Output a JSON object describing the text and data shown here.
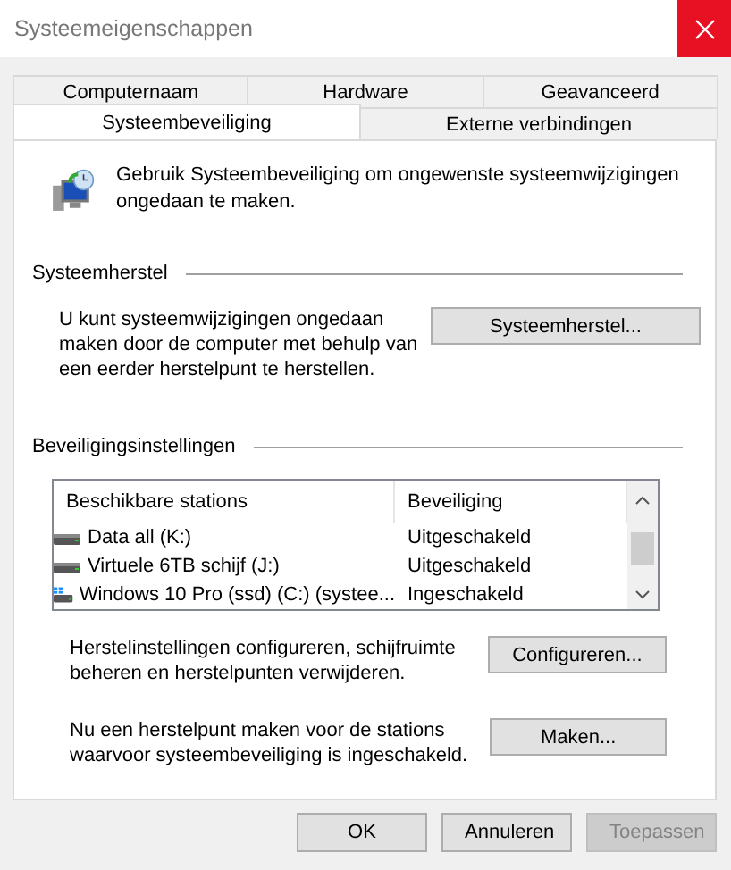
{
  "window": {
    "title": "Systeemeigenschappen"
  },
  "tab_rows": [
    [
      {
        "label": "Computernaam",
        "selected": false
      },
      {
        "label": "Hardware",
        "selected": false
      },
      {
        "label": "Geavanceerd",
        "selected": false
      }
    ],
    [
      {
        "label": "Systeembeveiliging",
        "selected": true
      },
      {
        "label": "Externe verbindingen",
        "selected": false
      }
    ]
  ],
  "intro": "Gebruik Systeembeveiliging om ongewenste systeemwijzigingen ongedaan te maken.",
  "restore": {
    "heading": "Systeemherstel",
    "text": "U kunt systeemwijzigingen ongedaan maken door de computer met behulp van een eerder herstelpunt te herstellen.",
    "button": "Systeemherstel..."
  },
  "protection": {
    "heading": "Beveiligingsinstellingen",
    "columns": [
      "Beschikbare stations",
      "Beveiliging"
    ],
    "rows": [
      {
        "kind": "drive",
        "name": "Data all (K:)",
        "status": "Uitgeschakeld"
      },
      {
        "kind": "drive",
        "name": "Virtuele 6TB schijf (J:)",
        "status": "Uitgeschakeld"
      },
      {
        "kind": "system",
        "name": "Windows 10 Pro (ssd) (C:) (systee...",
        "status": "Ingeschakeld"
      }
    ],
    "configure": {
      "text": "Herstelinstellingen configureren, schijfruimte beheren en herstelpunten verwijderen.",
      "button": "Configureren..."
    },
    "create": {
      "text": "Nu een herstelpunt maken voor de stations waarvoor systeembeveiliging is ingeschakeld.",
      "button": "Maken..."
    }
  },
  "buttons": [
    {
      "label": "OK",
      "disabled": false
    },
    {
      "label": "Annuleren",
      "disabled": false
    },
    {
      "label": "Toepassen",
      "disabled": true
    }
  ]
}
